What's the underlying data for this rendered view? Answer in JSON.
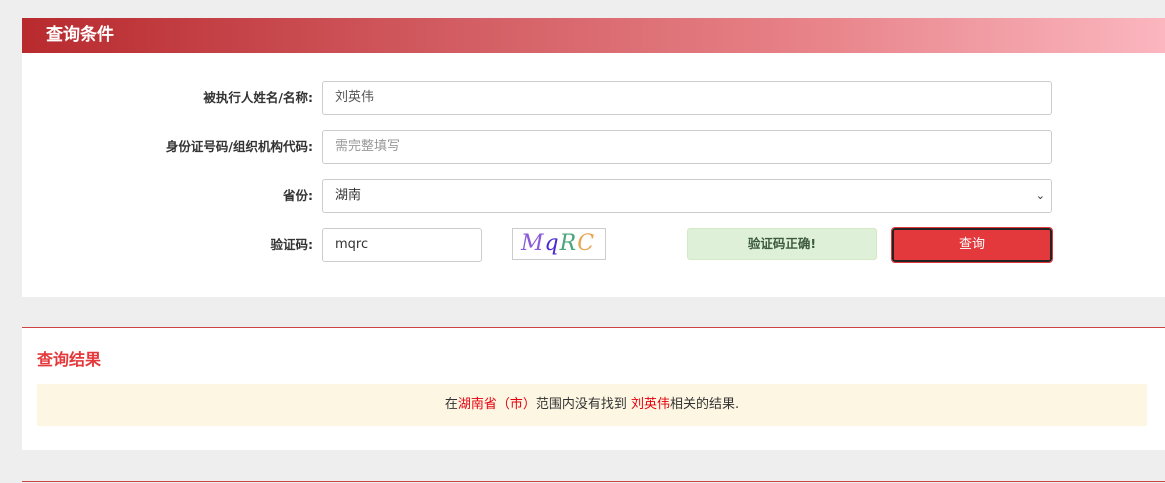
{
  "header": {
    "title": "查询条件"
  },
  "form": {
    "name_label": "被执行人姓名/名称:",
    "name_value": "刘英伟",
    "id_label": "身份证号码/组织机构代码:",
    "id_placeholder": "需完整填写",
    "province_label": "省份:",
    "province_value": "湖南",
    "captcha_label": "验证码:",
    "captcha_value": "mqrc",
    "captcha_image_text": "MqRC",
    "captcha_status": "验证码正确!",
    "search_button": "查询"
  },
  "result": {
    "title": "查询结果",
    "msg_prefix": "在",
    "msg_region": "湖南省（市）",
    "msg_mid": "范围内没有找到 ",
    "msg_name": "刘英伟",
    "msg_suffix": "相关的结果."
  },
  "colors": {
    "accent": "#e4393c",
    "success_bg": "#dff0d8",
    "notice_bg": "#fcf6e3"
  }
}
